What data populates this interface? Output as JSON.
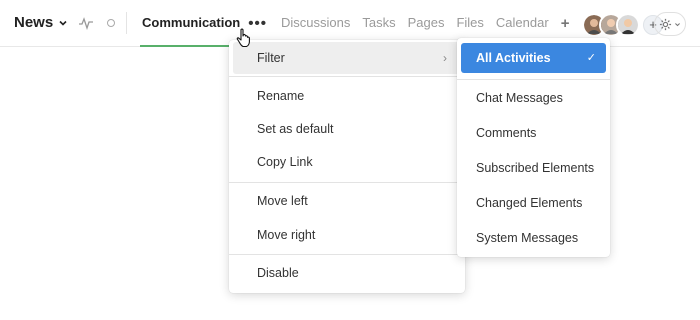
{
  "header": {
    "space_title": "News",
    "icons": {
      "space_menu": "chevron-down-icon",
      "activity": "pulse-icon",
      "status": "circle-icon",
      "more": "more-dots-icon",
      "add_tab": "plus-icon",
      "add_member": "plus-icon",
      "settings": "gear-icon"
    }
  },
  "tabs": [
    {
      "label": "Communication",
      "active": true
    },
    {
      "label": "Discussions",
      "active": false
    },
    {
      "label": "Tasks",
      "active": false
    },
    {
      "label": "Pages",
      "active": false
    },
    {
      "label": "Files",
      "active": false
    },
    {
      "label": "Calendar",
      "active": false
    }
  ],
  "more_label": "•••",
  "add_tab_label": "+",
  "add_member_label": "+",
  "menu": {
    "items": [
      {
        "label": "Filter",
        "has_submenu": true,
        "arrow": "›"
      },
      {
        "label": "Rename"
      },
      {
        "label": "Set as default"
      },
      {
        "label": "Copy Link"
      },
      {
        "label": "Move left"
      },
      {
        "label": "Move right"
      },
      {
        "label": "Disable"
      }
    ]
  },
  "submenu": {
    "items": [
      {
        "label": "All Activities",
        "selected": true,
        "check": "✓"
      },
      {
        "label": "Chat Messages"
      },
      {
        "label": "Comments"
      },
      {
        "label": "Subscribed Elements"
      },
      {
        "label": "Changed Elements"
      },
      {
        "label": "System Messages"
      }
    ]
  },
  "colors": {
    "active_tab_underline": "#58b06a",
    "selected_item_bg": "#3b87e0"
  }
}
